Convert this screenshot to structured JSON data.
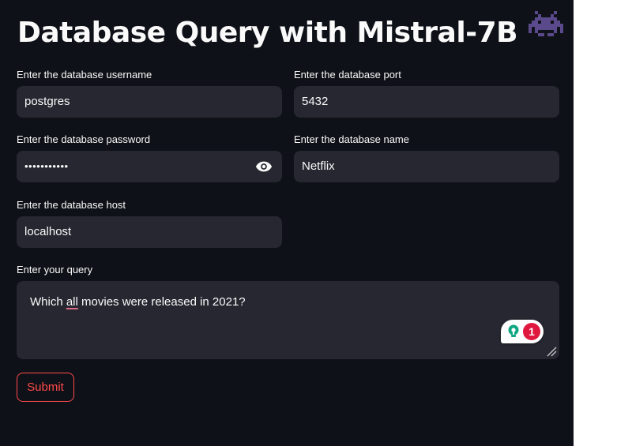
{
  "page": {
    "title": "Database Query with Mistral-7B",
    "title_icon": "alien-monster-icon"
  },
  "form": {
    "username": {
      "label": "Enter the database username",
      "value": "postgres"
    },
    "port": {
      "label": "Enter the database port",
      "value": "5432"
    },
    "password": {
      "label": "Enter the database password",
      "value": "•••••••••••",
      "toggle_icon": "eye-icon"
    },
    "dbname": {
      "label": "Enter the database name",
      "value": "Netflix"
    },
    "host": {
      "label": "Enter the database host",
      "value": "localhost"
    },
    "query": {
      "label": "Enter your query",
      "value_before": "Which ",
      "value_flagged": "all",
      "value_after": " movies were released in 2021?"
    },
    "submit_label": "Submit"
  },
  "grammarly": {
    "issue_count": "1",
    "icon": "lightbulb-icon"
  },
  "colors": {
    "background": "#0e1117",
    "input_background": "#262730",
    "text": "#fafafa",
    "accent": "#ff4b4b",
    "title_icon": "#5b4a8b"
  }
}
